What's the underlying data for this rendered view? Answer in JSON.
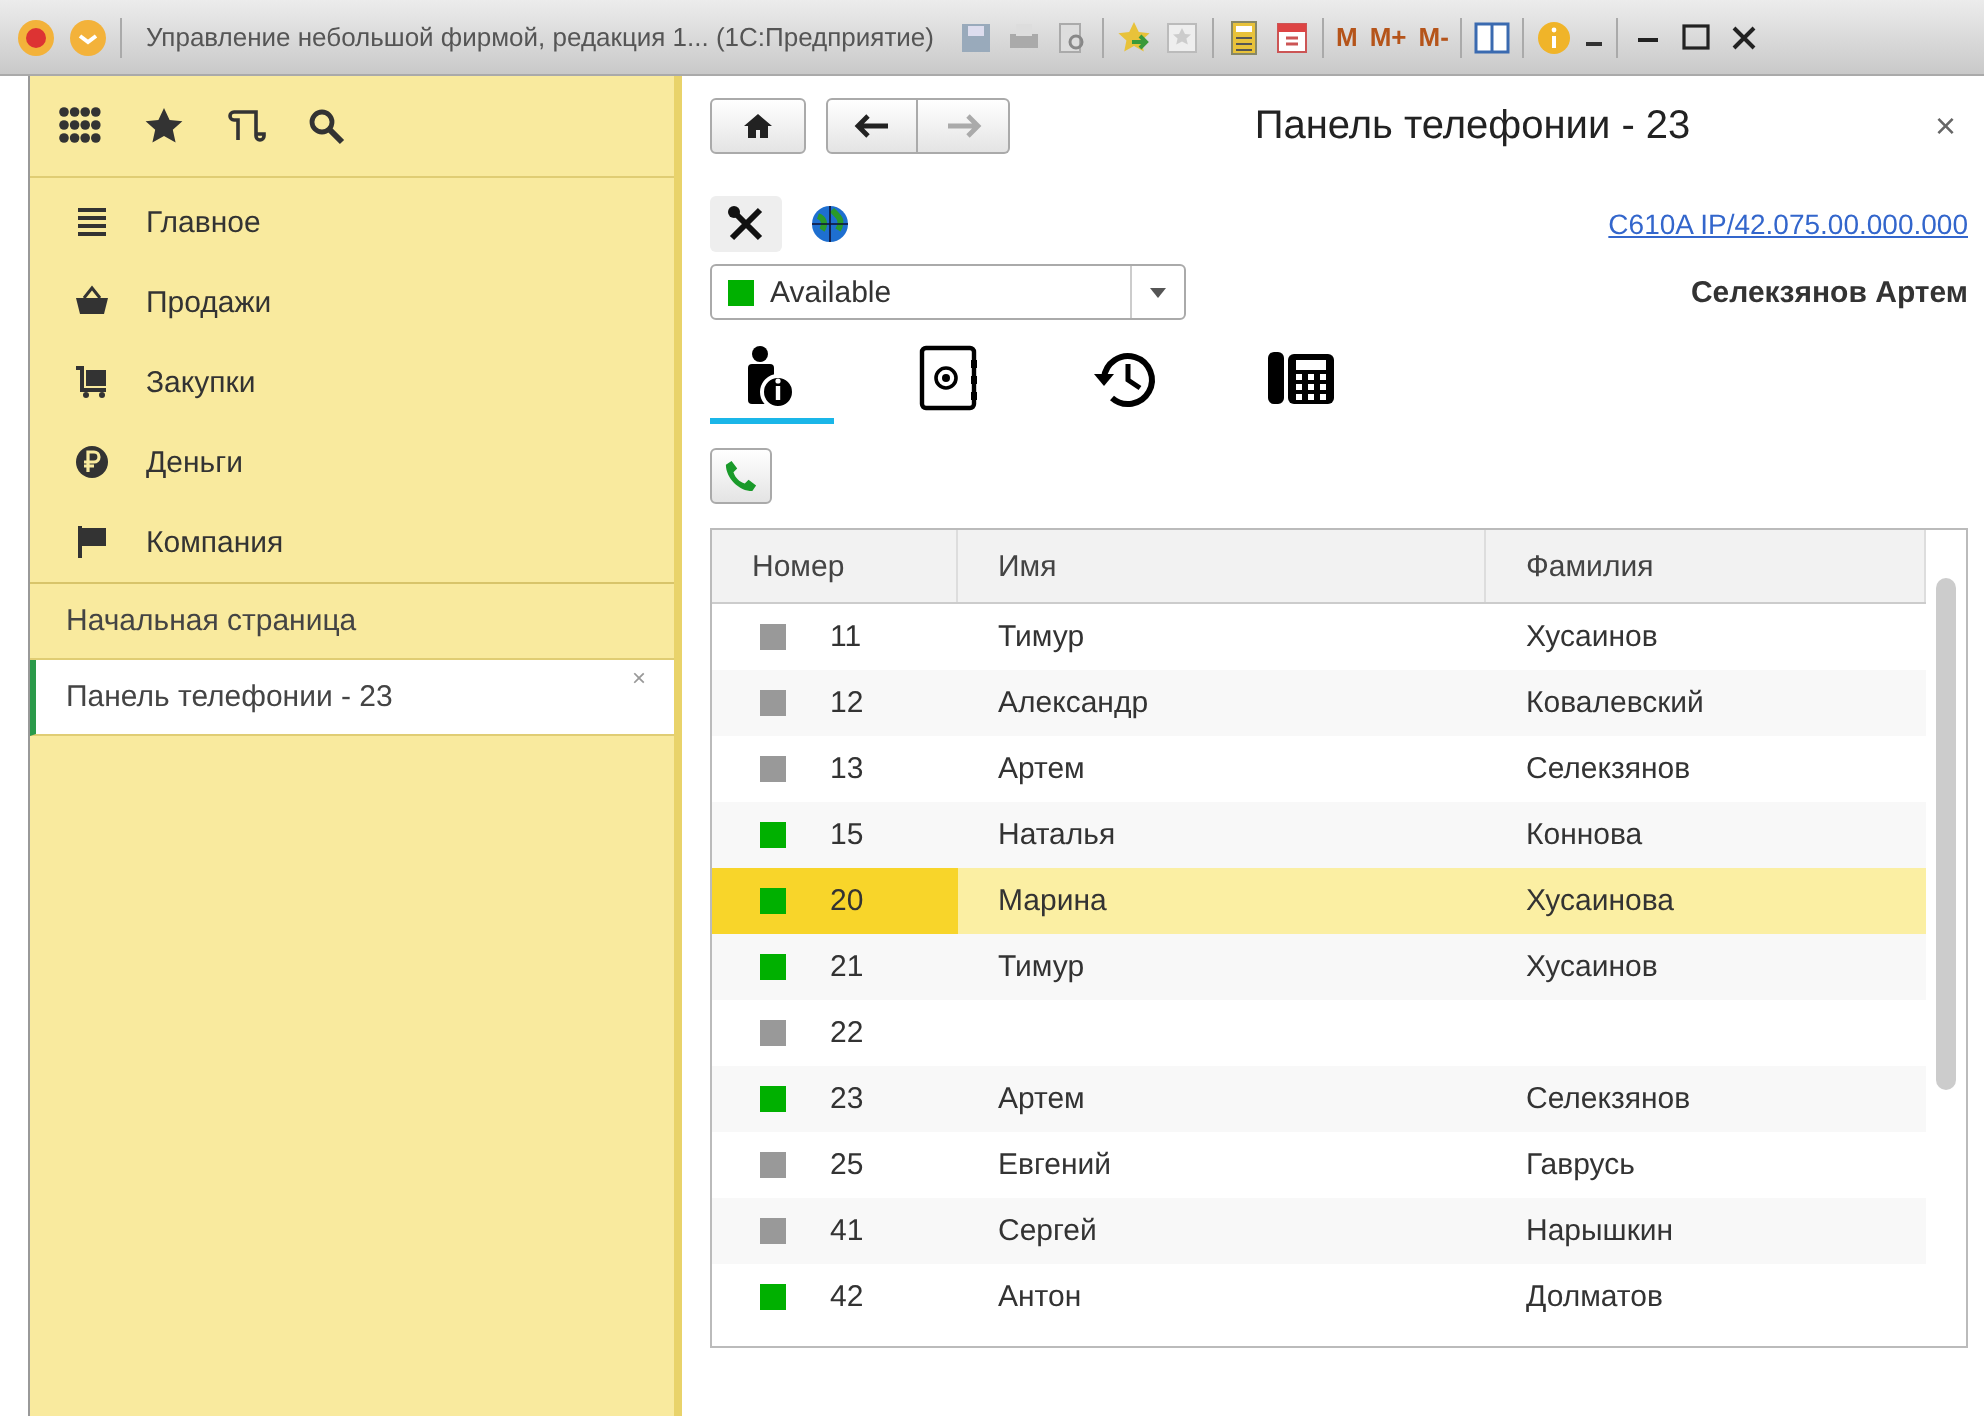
{
  "window": {
    "title": "Управление небольшой фирмой, редакция 1...  (1С:Предприятие)",
    "toolbar": [
      "M",
      "M+",
      "M-"
    ]
  },
  "sidebar": {
    "sections": [
      {
        "label": "Главное"
      },
      {
        "label": "Продажи"
      },
      {
        "label": "Закупки"
      },
      {
        "label": "Деньги"
      },
      {
        "label": "Компания"
      }
    ],
    "open_windows": [
      {
        "label": "Начальная страница",
        "selected": false
      },
      {
        "label": "Панель телефонии - 23",
        "selected": true,
        "close": "×"
      }
    ]
  },
  "panel": {
    "title": "Панель телефонии - 23",
    "close": "×",
    "device_link": "C610A IP/42.075.00.000.000",
    "status": {
      "value": "Available",
      "color": "#00b000"
    },
    "user": "Селекзянов Артем",
    "tabs": [
      {
        "selected": true
      },
      {
        "selected": false
      },
      {
        "selected": false
      },
      {
        "selected": false
      }
    ]
  },
  "table": {
    "columns": [
      "Номер",
      "Имя",
      "Фамилия"
    ],
    "rows": [
      {
        "number": "11",
        "first_name": "Тимур",
        "last_name": "Хусаинов",
        "color": "#999999",
        "selected": false
      },
      {
        "number": "12",
        "first_name": "Александр",
        "last_name": "Ковалевский",
        "color": "#999999",
        "selected": false
      },
      {
        "number": "13",
        "first_name": "Артем",
        "last_name": "Селекзянов",
        "color": "#999999",
        "selected": false
      },
      {
        "number": "15",
        "first_name": "Наталья",
        "last_name": "Коннова",
        "color": "#00b000",
        "selected": false
      },
      {
        "number": "20",
        "first_name": "Марина",
        "last_name": "Хусаинова",
        "color": "#00b000",
        "selected": true
      },
      {
        "number": "21",
        "first_name": "Тимур",
        "last_name": "Хусаинов",
        "color": "#00b000",
        "selected": false
      },
      {
        "number": "22",
        "first_name": "",
        "last_name": "",
        "color": "#999999",
        "selected": false
      },
      {
        "number": "23",
        "first_name": "Артем",
        "last_name": "Селекзянов",
        "color": "#00b000",
        "selected": false
      },
      {
        "number": "25",
        "first_name": "Евгений",
        "last_name": "Гаврусь",
        "color": "#999999",
        "selected": false
      },
      {
        "number": "41",
        "first_name": "Сергей",
        "last_name": "Нарышкин",
        "color": "#999999",
        "selected": false
      },
      {
        "number": "42",
        "first_name": "Антон",
        "last_name": "Долматов",
        "color": "#00b000",
        "selected": false
      }
    ]
  }
}
